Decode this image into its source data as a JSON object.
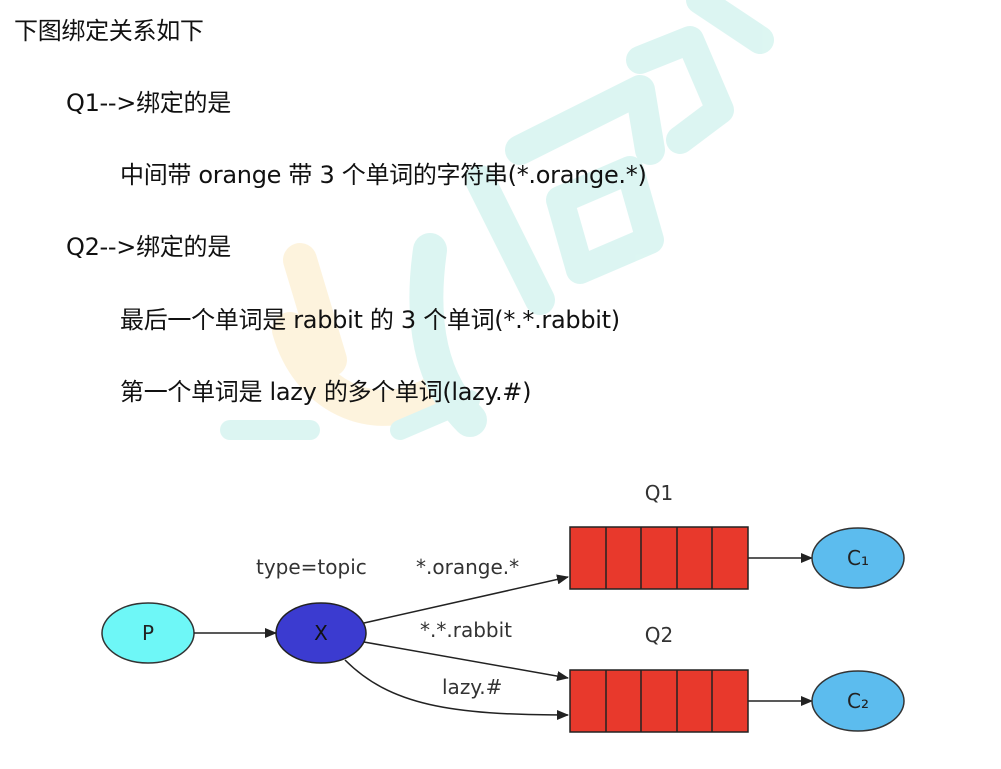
{
  "intro": {
    "heading": "下图绑定关系如下",
    "q1_title": "Q1-->绑定的是",
    "q1_desc": "中间带 orange 带 3 个单词的字符串(*.orange.*)",
    "q2_title": "Q2-->绑定的是",
    "q2_desc_1": "最后一个单词是 rabbit 的 3 个单词(*.*.rabbit)",
    "q2_desc_2": "第一个单词是 lazy 的多个单词(lazy.#)"
  },
  "diagram": {
    "producer": "P",
    "exchange": "X",
    "exchange_type": "type=topic",
    "queue1": "Q1",
    "queue2": "Q2",
    "consumer1": "C₁",
    "consumer2": "C₂",
    "binding_orange": "*.orange.*",
    "binding_rabbit": "*.*.rabbit",
    "binding_lazy": "lazy.#",
    "colors": {
      "producer_fill": "#6ef7f7",
      "exchange_fill": "#3b3bd0",
      "queue_fill": "#e8392c",
      "consumer_fill": "#5cbcee",
      "watermark_teal": "#2ec4b0",
      "watermark_orange": "#f7b733"
    }
  }
}
